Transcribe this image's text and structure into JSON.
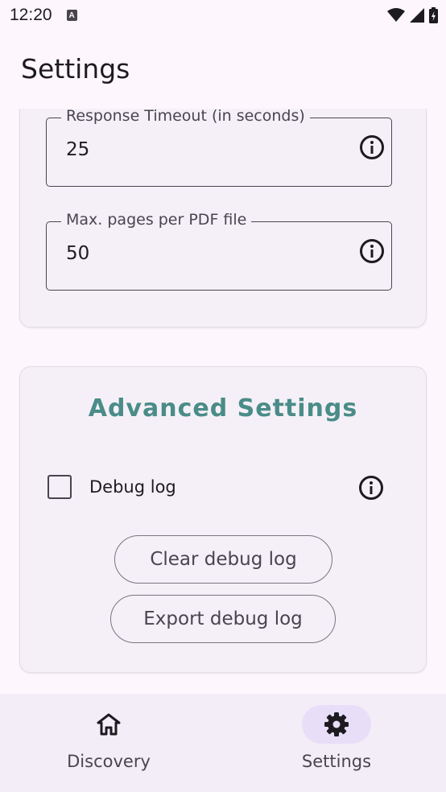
{
  "status_bar": {
    "time": "12:20",
    "notification_icon_letter": "A"
  },
  "app_bar": {
    "title": "Settings"
  },
  "fields": [
    {
      "label": "Response Timeout (in seconds)",
      "value": "25"
    },
    {
      "label": "Max. pages per PDF file",
      "value": "50"
    }
  ],
  "advanced": {
    "title": "Advanced Settings",
    "debug_log_label": "Debug log",
    "debug_log_checked": false,
    "clear_button": "Clear debug log",
    "export_button": "Export debug log"
  },
  "bottom_nav": {
    "items": [
      {
        "label": "Discovery",
        "icon": "home-icon",
        "selected": false
      },
      {
        "label": "Settings",
        "icon": "gear-icon",
        "selected": true
      }
    ]
  },
  "colors": {
    "background": "#fdf7fd",
    "card": "#f5f0f7",
    "accent_title": "#4a8c88",
    "nav_indicator": "#e8def8"
  }
}
